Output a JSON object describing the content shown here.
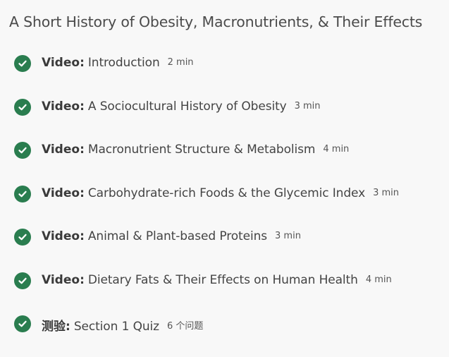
{
  "module": {
    "title": "A Short History of Obesity, Macronutrients, & Their Effects"
  },
  "items": [
    {
      "type": "Video:",
      "name": "Introduction",
      "duration": "2 min",
      "status_icon": "check-circle-icon"
    },
    {
      "type": "Video:",
      "name": "A Sociocultural History of Obesity",
      "duration": "3 min",
      "status_icon": "check-circle-icon"
    },
    {
      "type": "Video:",
      "name": "Macronutrient Structure & Metabolism",
      "duration": "4 min",
      "status_icon": "check-circle-icon"
    },
    {
      "type": "Video:",
      "name": "Carbohydrate-rich Foods & the Glycemic Index",
      "duration": "3 min",
      "status_icon": "check-circle-icon"
    },
    {
      "type": "Video:",
      "name": "Animal & Plant-based Proteins",
      "duration": "3 min",
      "status_icon": "check-circle-icon"
    },
    {
      "type": "Video:",
      "name": "Dietary Fats & Their Effects on Human Health",
      "duration": "4 min",
      "status_icon": "check-circle-icon"
    },
    {
      "type": "测验:",
      "name": "Section 1 Quiz",
      "duration": "6 个问题",
      "status_icon": "check-circle-icon"
    }
  ],
  "colors": {
    "completed": "#2a7d4f",
    "background": "#f8f8f8"
  }
}
